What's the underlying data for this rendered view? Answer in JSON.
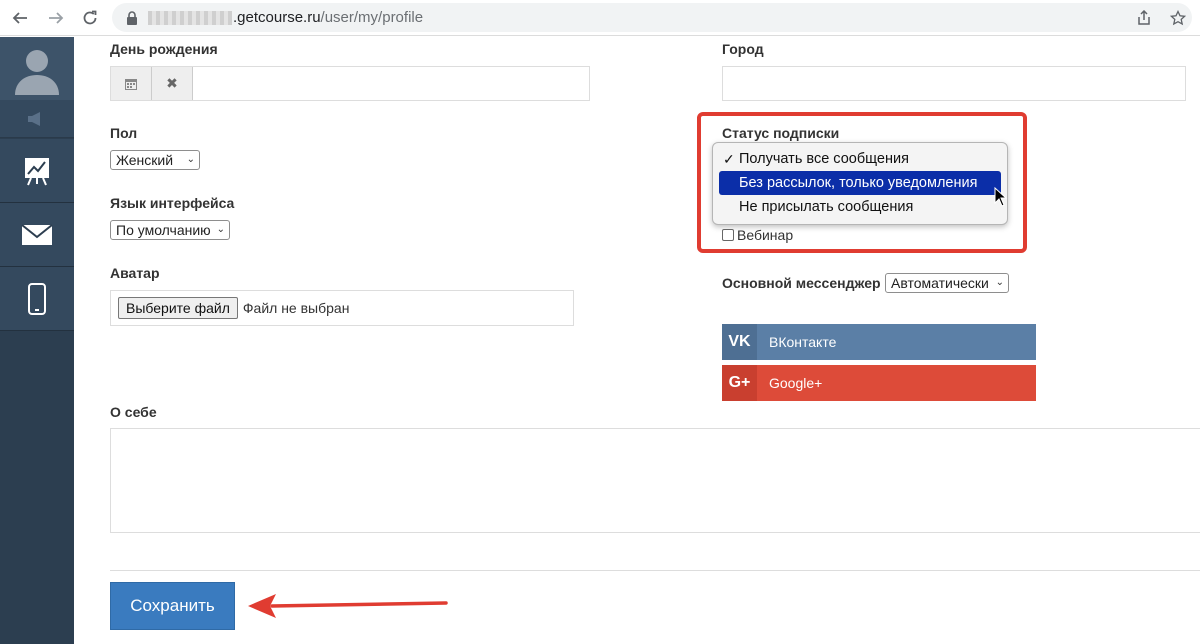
{
  "browser": {
    "url_domain": ".getcourse.ru",
    "url_path": "/user/my/profile"
  },
  "form": {
    "birthday_label": "День рождения",
    "city_label": "Город",
    "gender_label": "Пол",
    "gender_value": "Женский",
    "language_label": "Язык интерфейса",
    "language_value": "По умолчанию",
    "avatar_label": "Аватар",
    "file_button": "Выберите файл",
    "file_status": "Файл не выбран",
    "about_label": "О себе",
    "save_label": "Сохранить",
    "subscription_label": "Статус подписки",
    "subscription_options": [
      "Получать все сообщения",
      "Без рассылок, только уведомления",
      "Не присылать сообщения"
    ],
    "subscription_checked": 0,
    "subscription_highlighted": 1,
    "webinar_label": "Вебинар",
    "messenger_label": "Основной мессенджер",
    "messenger_value": "Автоматически",
    "vk_label": "ВКонтакте",
    "vk_icon": "VK",
    "google_label": "Google+",
    "google_icon": "G+"
  },
  "colors": {
    "sidebar": "#2c3e50",
    "save": "#3a7bbf",
    "vk": "#5b7fa6",
    "google": "#dd4b39",
    "highlight": "#0b2ea8",
    "annotation": "#e03c31"
  }
}
